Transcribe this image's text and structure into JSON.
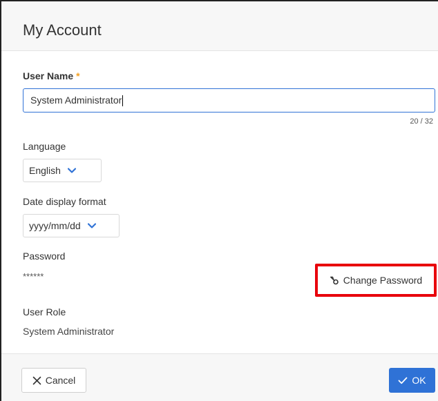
{
  "dialog": {
    "title": "My Account"
  },
  "user_name": {
    "label": "User Name",
    "required_marker": "*",
    "value": "System Administrator",
    "counter": "20 / 32"
  },
  "language": {
    "label": "Language",
    "selected": "English"
  },
  "date_format": {
    "label": "Date display format",
    "selected": "yyyy/mm/dd"
  },
  "password": {
    "label": "Password",
    "value": "******",
    "change_button_label": "Change Password"
  },
  "user_role": {
    "label": "User Role",
    "value": "System Administrator"
  },
  "footer": {
    "cancel_label": "Cancel",
    "ok_label": "OK"
  },
  "colors": {
    "accent": "#2f72d6",
    "required": "#f4a020",
    "highlight": "#e8000b"
  },
  "icons": {
    "change_password": "key-icon",
    "cancel": "close-icon",
    "ok": "checkmark-icon",
    "select": "chevron-down-icon"
  }
}
